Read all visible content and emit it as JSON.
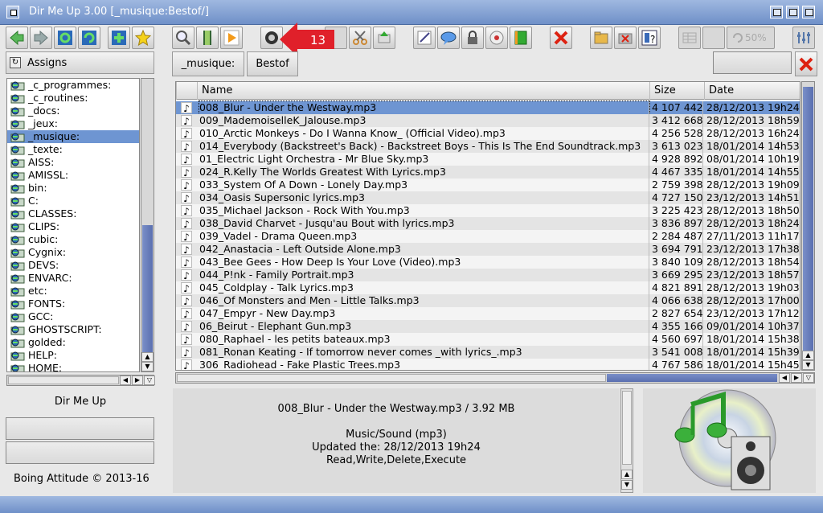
{
  "window": {
    "title": "Dir Me Up 3.00 [_musique:Bestof/]"
  },
  "toolbar": {
    "callout_number": "13",
    "zoom_percent": "50%"
  },
  "left_panel": {
    "assigns_label": "Assigns",
    "volumes": [
      "_c_programmes:",
      "_c_routines:",
      "_docs:",
      "_jeux:",
      "_musique:",
      "_texte:",
      "AISS:",
      "AMISSL:",
      "bin:",
      "C:",
      "CLASSES:",
      "CLIPS:",
      "cubic:",
      "Cygnix:",
      "DEVS:",
      "ENVARC:",
      "etc:",
      "FONTS:",
      "GCC:",
      "GHOSTSCRIPT:",
      "golded:",
      "HELP:",
      "HOME:"
    ],
    "selected_volume_index": 4,
    "app_name": "Dir Me Up",
    "copyright": "Boing Attitude © 2013-16"
  },
  "path_bar": {
    "segments": [
      "_musique:",
      "Bestof"
    ]
  },
  "file_list": {
    "columns": {
      "name": "Name",
      "size": "Size",
      "date": "Date"
    },
    "rows": [
      {
        "name": "008_Blur - Under the Westway.mp3",
        "size": "4 107 442",
        "date": "28/12/2013 19h24"
      },
      {
        "name": "009_MademoiselleK_Jalouse.mp3",
        "size": "3 412 668",
        "date": "28/12/2013 18h59"
      },
      {
        "name": "010_Arctic Monkeys - Do I Wanna Know_ (Official Video).mp3",
        "size": "4 256 528",
        "date": "28/12/2013 16h24"
      },
      {
        "name": "014_Everybody (Backstreet's Back) - Backstreet Boys - This Is The End Soundtrack.mp3",
        "size": "3 613 023",
        "date": "18/01/2014 14h53"
      },
      {
        "name": "01_Electric Light Orchestra - Mr  Blue Sky.mp3",
        "size": "4 928 892",
        "date": "08/01/2014 10h19"
      },
      {
        "name": "024_R.Kelly The Worlds Greatest With Lyrics.mp3",
        "size": "4 467 335",
        "date": "18/01/2014 14h55"
      },
      {
        "name": "033_System Of A Down - Lonely Day.mp3",
        "size": "2 759 398",
        "date": "28/12/2013 19h09"
      },
      {
        "name": "034_Oasis Supersonic lyrics.mp3",
        "size": "4 727 150",
        "date": "23/12/2013 14h51"
      },
      {
        "name": "035_Michael Jackson - Rock With You.mp3",
        "size": "3 225 423",
        "date": "28/12/2013 18h50"
      },
      {
        "name": "038_David Charvet - Jusqu'au Bout with lyrics.mp3",
        "size": "3 836 897",
        "date": "28/12/2013 18h24"
      },
      {
        "name": "039_Vadel - Drama Queen.mp3",
        "size": "2 284 487",
        "date": "27/11/2013 11h17"
      },
      {
        "name": "042_Anastacia - Left Outside Alone.mp3",
        "size": "3 694 791",
        "date": "23/12/2013 17h38"
      },
      {
        "name": "043_Bee Gees - How Deep Is Your Love (Video).mp3",
        "size": "3 840 109",
        "date": "28/12/2013 18h54"
      },
      {
        "name": "044_P!nk - Family Portrait.mp3",
        "size": "3 669 295",
        "date": "23/12/2013 18h57"
      },
      {
        "name": "045_Coldplay - Talk Lyrics.mp3",
        "size": "4 821 891",
        "date": "28/12/2013 19h03"
      },
      {
        "name": "046_Of Monsters and Men - Little Talks.mp3",
        "size": "4 066 638",
        "date": "28/12/2013 17h00"
      },
      {
        "name": "047_Empyr - New Day.mp3",
        "size": "2 827 654",
        "date": "23/12/2013 17h12"
      },
      {
        "name": "06_Beirut - Elephant Gun.mp3",
        "size": "4 355 166",
        "date": "09/01/2014 10h37"
      },
      {
        "name": "080_Raphael - les petits bateaux.mp3",
        "size": "4 560 697",
        "date": "18/01/2014 15h38"
      },
      {
        "name": "081_Ronan Keating - If tomorrow never comes _with lyrics_.mp3",
        "size": "3 541 008",
        "date": "18/01/2014 15h39"
      },
      {
        "name": "306_Radiohead - Fake Plastic Trees.mp3",
        "size": "4 767 586",
        "date": "18/01/2014 15h45"
      }
    ],
    "selected_row_index": 0
  },
  "info_panel": {
    "file_summary": "008_Blur - Under the Westway.mp3 / 3.92 MB",
    "file_type": "Music/Sound (mp3)",
    "updated": "Updated the: 28/12/2013 19h24",
    "permissions": "Read,Write,Delete,Execute"
  },
  "icons": {
    "accent": "#6e95d2",
    "scroll_knob": "#6a7fc0",
    "callout_red": "#e0202a"
  }
}
